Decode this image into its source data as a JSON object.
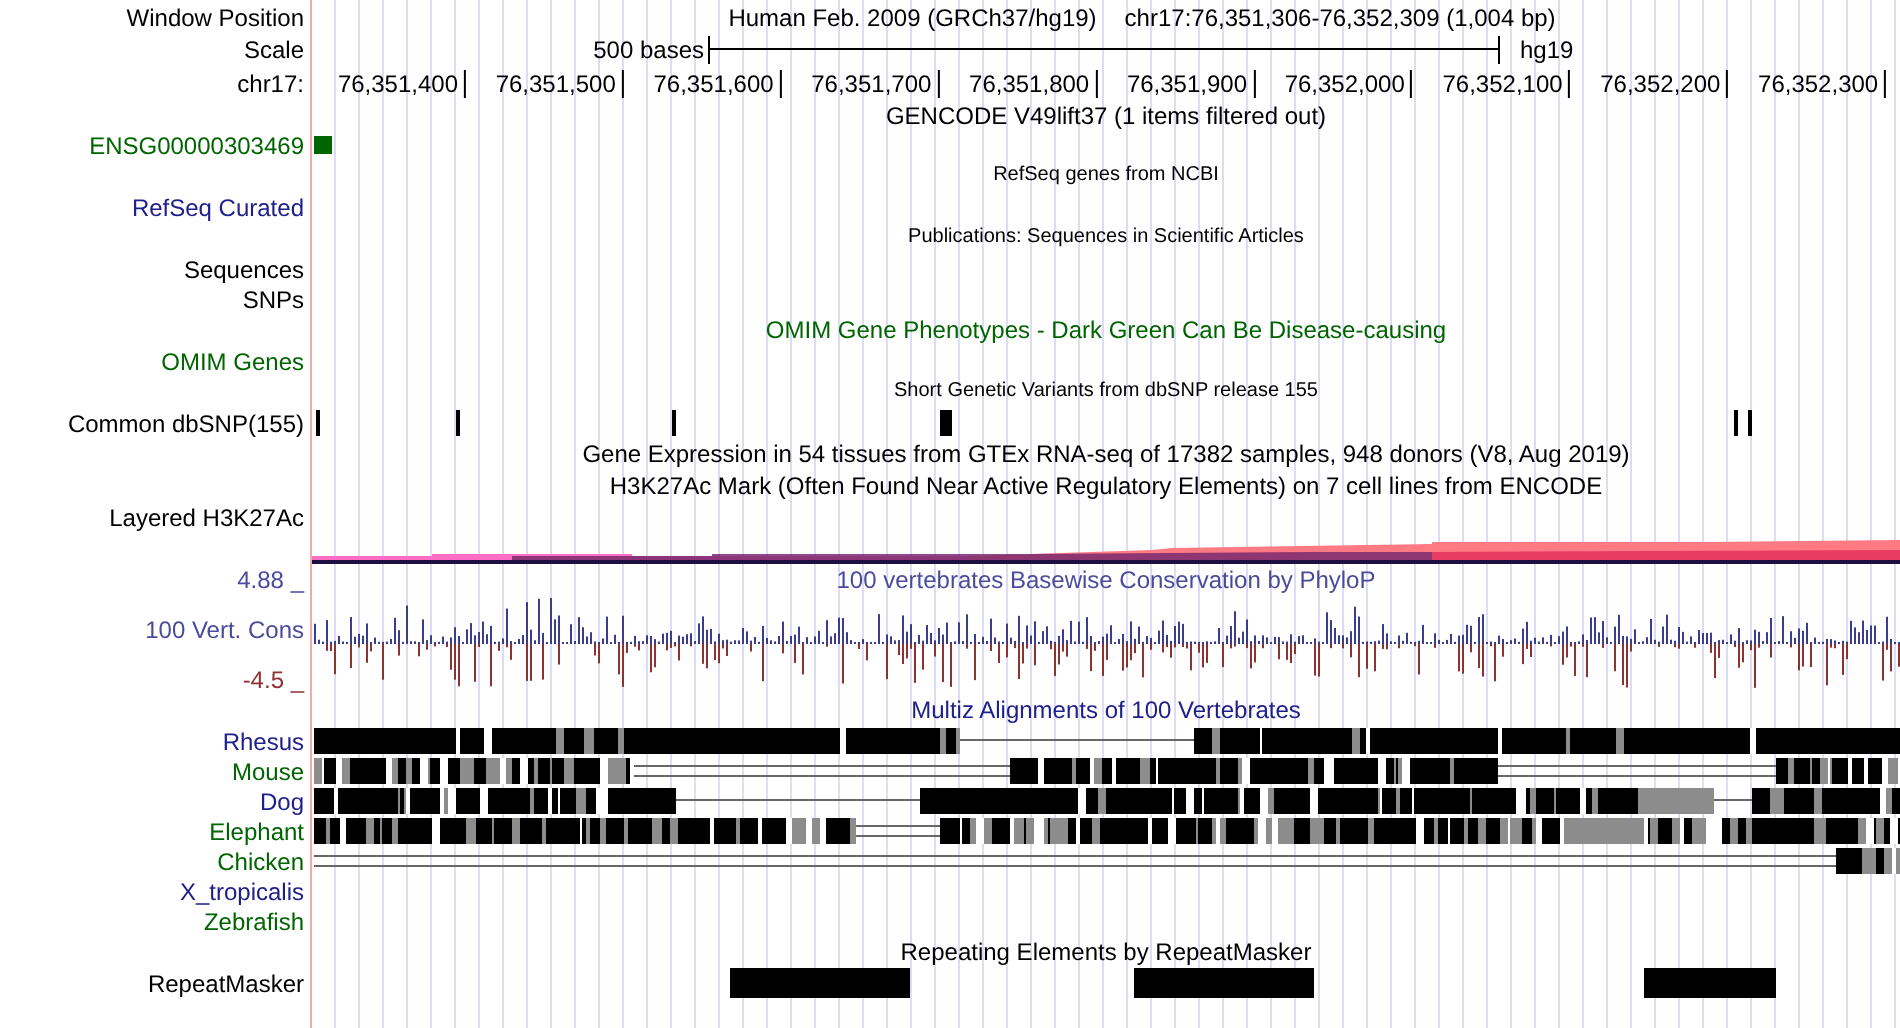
{
  "header": {
    "position_label": "Window Position",
    "assembly_title": "Human Feb. 2009 (GRCh37/hg19)",
    "position": "chr17:76,351,306-76,352,309 (1,004 bp)",
    "scale_label": "Scale",
    "scale_text": "500 bases",
    "scale_assembly": "hg19",
    "chrom_label": "chr17:",
    "ticks": [
      "76,351,400",
      "76,351,500",
      "76,351,600",
      "76,351,700",
      "76,351,800",
      "76,351,900",
      "76,352,000",
      "76,352,100",
      "76,352,200",
      "76,352,300"
    ]
  },
  "tracks": [
    {
      "kind": "title",
      "text": "GENCODE V49lift37 (1 items filtered out)",
      "color": "#000000"
    },
    {
      "kind": "gene",
      "label": "ENSG00000303469",
      "color": "#006400"
    },
    {
      "kind": "caption",
      "text": "RefSeq genes from NCBI",
      "color": "#000000"
    },
    {
      "kind": "label",
      "label": "RefSeq Curated",
      "color": "#20208c"
    },
    {
      "kind": "caption",
      "text": "Publications: Sequences in Scientific Articles",
      "color": "#000000"
    },
    {
      "kind": "label",
      "label": "Sequences",
      "color": "#000000"
    },
    {
      "kind": "label",
      "label": "SNPs",
      "color": "#000000"
    },
    {
      "kind": "title",
      "text": "OMIM Gene Phenotypes - Dark Green Can Be Disease-causing",
      "color": "#006400"
    },
    {
      "kind": "label",
      "label": "OMIM Genes",
      "color": "#006400"
    },
    {
      "kind": "caption",
      "text": "Short Genetic Variants from dbSNP release 155",
      "color": "#000000"
    },
    {
      "kind": "snps",
      "label": "Common dbSNP(155)",
      "color": "#000000"
    },
    {
      "kind": "title",
      "text": "Gene Expression in 54 tissues from GTEx RNA-seq of 17382 samples, 948 donors (V8, Aug 2019)",
      "color": "#000000"
    },
    {
      "kind": "title",
      "text": "H3K27Ac Mark (Often Found Near Active Regulatory Elements) on 7 cell lines from ENCODE",
      "color": "#000000"
    },
    {
      "kind": "label",
      "label": "Layered H3K27Ac",
      "color": "#000000"
    },
    {
      "kind": "layered"
    },
    {
      "kind": "conservation",
      "title": "100 vertebrates Basewise Conservation by PhyloP",
      "label": "100 Vert. Cons",
      "max": "4.88 _",
      "min": "-4.5 _",
      "color": "#4b4b9b"
    },
    {
      "kind": "title",
      "text": "Multiz Alignments of 100 Vertebrates",
      "color": "#20208c"
    },
    {
      "kind": "alignment",
      "label": "Rhesus",
      "color": "#20208c"
    },
    {
      "kind": "alignment",
      "label": "Mouse",
      "color": "#006400"
    },
    {
      "kind": "alignment",
      "label": "Dog",
      "color": "#20208c"
    },
    {
      "kind": "alignment",
      "label": "Elephant",
      "color": "#006400"
    },
    {
      "kind": "alignment",
      "label": "Chicken",
      "color": "#006400"
    },
    {
      "kind": "alignment",
      "label": "X_tropicalis",
      "color": "#20208c"
    },
    {
      "kind": "alignment",
      "label": "Zebrafish",
      "color": "#006400"
    },
    {
      "kind": "title",
      "text": "Repeating Elements by RepeatMasker",
      "color": "#000000"
    },
    {
      "kind": "repeats",
      "label": "RepeatMasker",
      "color": "#000000"
    }
  ]
}
